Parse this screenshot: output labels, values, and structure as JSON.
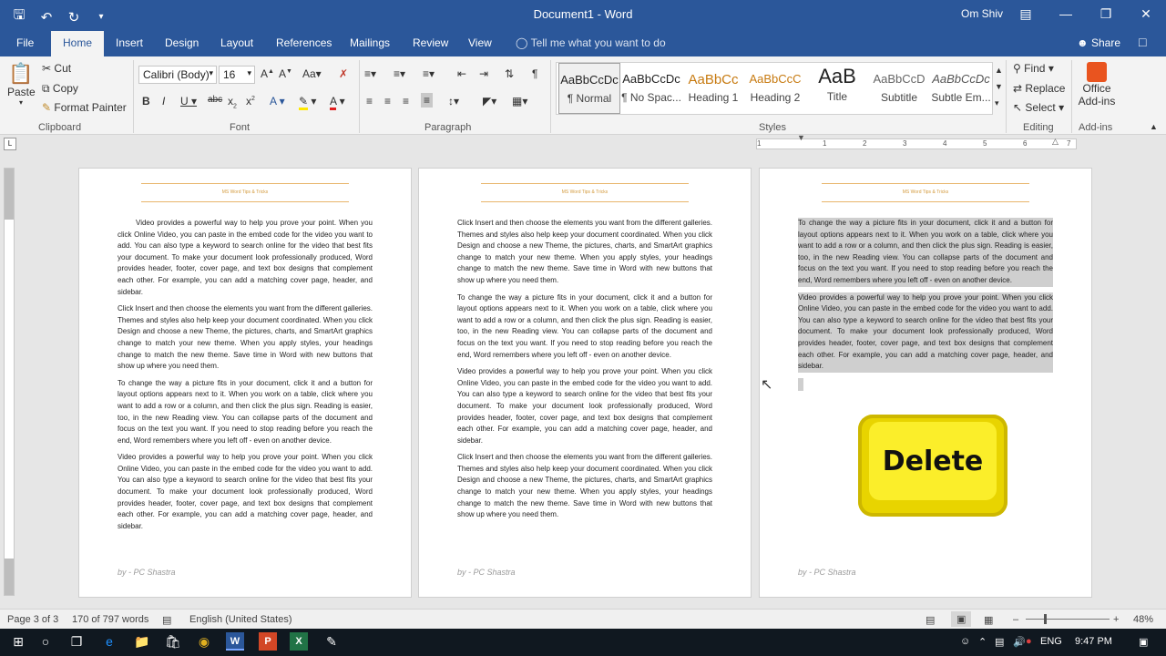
{
  "window": {
    "title": "Document1 - Word",
    "user": "Om Shiv",
    "qat": [
      "save-icon",
      "undo-icon",
      "redo-icon",
      "customize-icon"
    ]
  },
  "tabs": [
    "File",
    "Home",
    "Insert",
    "Design",
    "Layout",
    "References",
    "Mailings",
    "Review",
    "View"
  ],
  "tell_me": "Tell me what you want to do",
  "share": "Share",
  "ribbon": {
    "clipboard": {
      "paste": "Paste",
      "cut": "Cut",
      "copy": "Copy",
      "format_painter": "Format Painter",
      "label": "Clipboard"
    },
    "font": {
      "family": "Calibri (Body)",
      "size": "16",
      "label": "Font"
    },
    "paragraph": {
      "label": "Paragraph"
    },
    "styles": {
      "label": "Styles",
      "items": [
        {
          "preview": "AaBbCcDc",
          "name": "¶ Normal"
        },
        {
          "preview": "AaBbCcDc",
          "name": "¶ No Spac..."
        },
        {
          "preview": "AaBbCc",
          "name": "Heading 1"
        },
        {
          "preview": "AaBbCcC",
          "name": "Heading 2"
        },
        {
          "preview": "AaB",
          "name": "Title"
        },
        {
          "preview": "AaBbCcD",
          "name": "Subtitle"
        },
        {
          "preview": "AaBbCcDc",
          "name": "Subtle Em..."
        }
      ]
    },
    "editing": {
      "find": "Find",
      "replace": "Replace",
      "select": "Select",
      "label": "Editing"
    },
    "addins": {
      "office": "Office",
      "addins": "Add-ins",
      "label": "Add-ins"
    }
  },
  "ruler": {
    "marks": [
      "1",
      "1",
      "2",
      "3",
      "4",
      "5",
      "6",
      "7"
    ]
  },
  "pages": [
    {
      "header": "MS Word Tips & Tricks",
      "paragraphs": [
        "Video provides a powerful way to help you prove your point. When you click Online Video, you can paste in the embed code for the video you want to add. You can also type a keyword to search online for the video that best fits your document. To make your document look professionally produced, Word provides header, footer, cover page, and text box designs that complement each other. For example, you can add a matching cover page, header, and sidebar.",
        "Click Insert and then choose the elements you want from the different galleries. Themes and styles also help keep your document coordinated. When you click Design and choose a new Theme, the pictures, charts, and SmartArt graphics change to match your new theme. When you apply styles, your headings change to match the new theme. Save time in Word with new buttons that show up where you need them.",
        "To change the way a picture fits in your document, click it and a button for layout options appears next to it. When you work on a table, click where you want to add a row or a column, and then click the plus sign. Reading is easier, too, in the new Reading view. You can collapse parts of the document and focus on the text you want. If you need to stop reading before you reach the end, Word remembers where you left off - even on another device.",
        "Video provides a powerful way to help you prove your point. When you click Online Video, you can paste in the embed code for the video you want to add. You can also type a keyword to search online for the video that best fits your document. To make your document look professionally produced, Word provides header, footer, cover page, and text box designs that complement each other. For example, you can add a matching cover page, header, and sidebar."
      ],
      "footer": "by - PC Shastra"
    },
    {
      "header": "MS Word Tips & Tricks",
      "paragraphs": [
        "Click Insert and then choose the elements you want from the different galleries. Themes and styles also help keep your document coordinated. When you click Design and choose a new Theme, the pictures, charts, and SmartArt graphics change to match your new theme. When you apply styles, your headings change to match the new theme. Save time in Word with new buttons that show up where you need them.",
        "To change the way a picture fits in your document, click it and a button for layout options appears next to it. When you work on a table, click where you want to add a row or a column, and then click the plus sign. Reading is easier, too, in the new Reading view. You can collapse parts of the document and focus on the text you want. If you need to stop reading before you reach the end, Word remembers where you left off - even on another device.",
        "Video provides a powerful way to help you prove your point. When you click Online Video, you can paste in the embed code for the video you want to add. You can also type a keyword to search online for the video that best fits your document. To make your document look professionally produced, Word provides header, footer, cover page, and text box designs that complement each other. For example, you can add a matching cover page, header, and sidebar.",
        "Click Insert and then choose the elements you want from the different galleries. Themes and styles also help keep your document coordinated. When you click Design and choose a new Theme, the pictures, charts, and SmartArt graphics change to match your new theme. When you apply styles, your headings change to match the new theme. Save time in Word with new buttons that show up where you need them."
      ],
      "footer": "by - PC Shastra"
    },
    {
      "header": "MS Word Tips & Tricks",
      "paragraphs": [
        "To change the way a picture fits in your document, click it and a button for layout options appears next to it. When you work on a table, click where you want to add a row or a column, and then click the plus sign. Reading is easier, too, in the new Reading view. You can collapse parts of the document and focus on the text you want. If you need to stop reading before you reach the end, Word remembers where you left off - even on another device.",
        "Video provides a powerful way to help you prove your point. When you click Online Video, you can paste in the embed code for the video you want to add. You can also type a keyword to search online for the video that best fits your document. To make your document look professionally produced, Word provides header, footer, cover page, and text box designs that complement each other. For example, you can add a matching cover page, header, and sidebar."
      ],
      "footer": "by - PC Shastra",
      "key_label": "Delete"
    }
  ],
  "status": {
    "page": "Page 3 of 3",
    "words": "170 of 797 words",
    "language": "English (United States)",
    "zoom": "48%",
    "zoom_level": 0.48
  },
  "taskbar": {
    "apps": [
      "W",
      "P",
      "X"
    ],
    "lang": "ENG",
    "time": "9:47 PM"
  },
  "colors": {
    "accent": "#2b579a",
    "selection": "#cfcfcf",
    "delete_key": "#fbee2a"
  }
}
